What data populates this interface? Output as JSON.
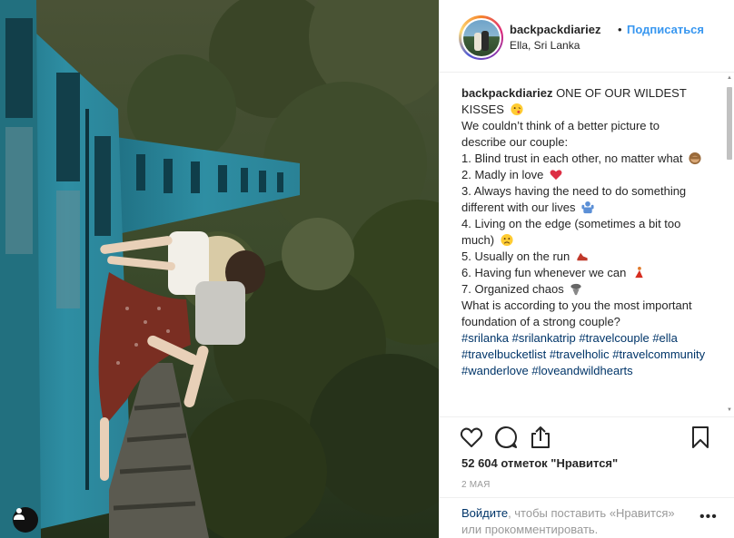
{
  "post": {
    "username": "backpackdiariez",
    "separator": "•",
    "follow_label": "Подписаться",
    "location": "Ella, Sri Lanka"
  },
  "caption": {
    "username": "backpackdiariez",
    "lines": [
      " ONE OF OUR WILDEST KISSES ",
      "We couldn’t think of a better picture to describe our couple:",
      "1. Blind trust in each other, no matter what ",
      "2. Madly in love ",
      "3. Always having the need to do something different with our lives ",
      "4. Living on the edge (sometimes a bit too much) ",
      "5. Usually on the run ",
      "6. Having fun whenever we can ",
      "7. Organized chaos ",
      "What is according to you the most important foundation of a strong couple?"
    ],
    "hashtags": [
      "#srilanka",
      "#srilankatrip",
      "#travelcouple",
      "#ella",
      "#travelbucketlist",
      "#travelholic",
      "#travelcommunity",
      "#wanderlove",
      "#loveandwildhearts"
    ]
  },
  "stats": {
    "likes_text": "52 604 отметок \"Нравится\"",
    "date_text": "2 мая"
  },
  "login": {
    "link_text": "Войдите",
    "rest_text": ", чтобы поставить «Нравится» или прокомментировать.",
    "more_label": "•••"
  },
  "icons": {
    "like": "heart-icon",
    "comment": "comment-icon",
    "share": "share-icon",
    "save": "bookmark-icon",
    "user_tag": "person-icon",
    "options": "more-icon"
  },
  "colors": {
    "link_blue": "#3897f0",
    "hashtag_blue": "#003569",
    "train_teal": "#2e8ea3",
    "text_dark": "#262626",
    "text_muted": "#999999"
  }
}
